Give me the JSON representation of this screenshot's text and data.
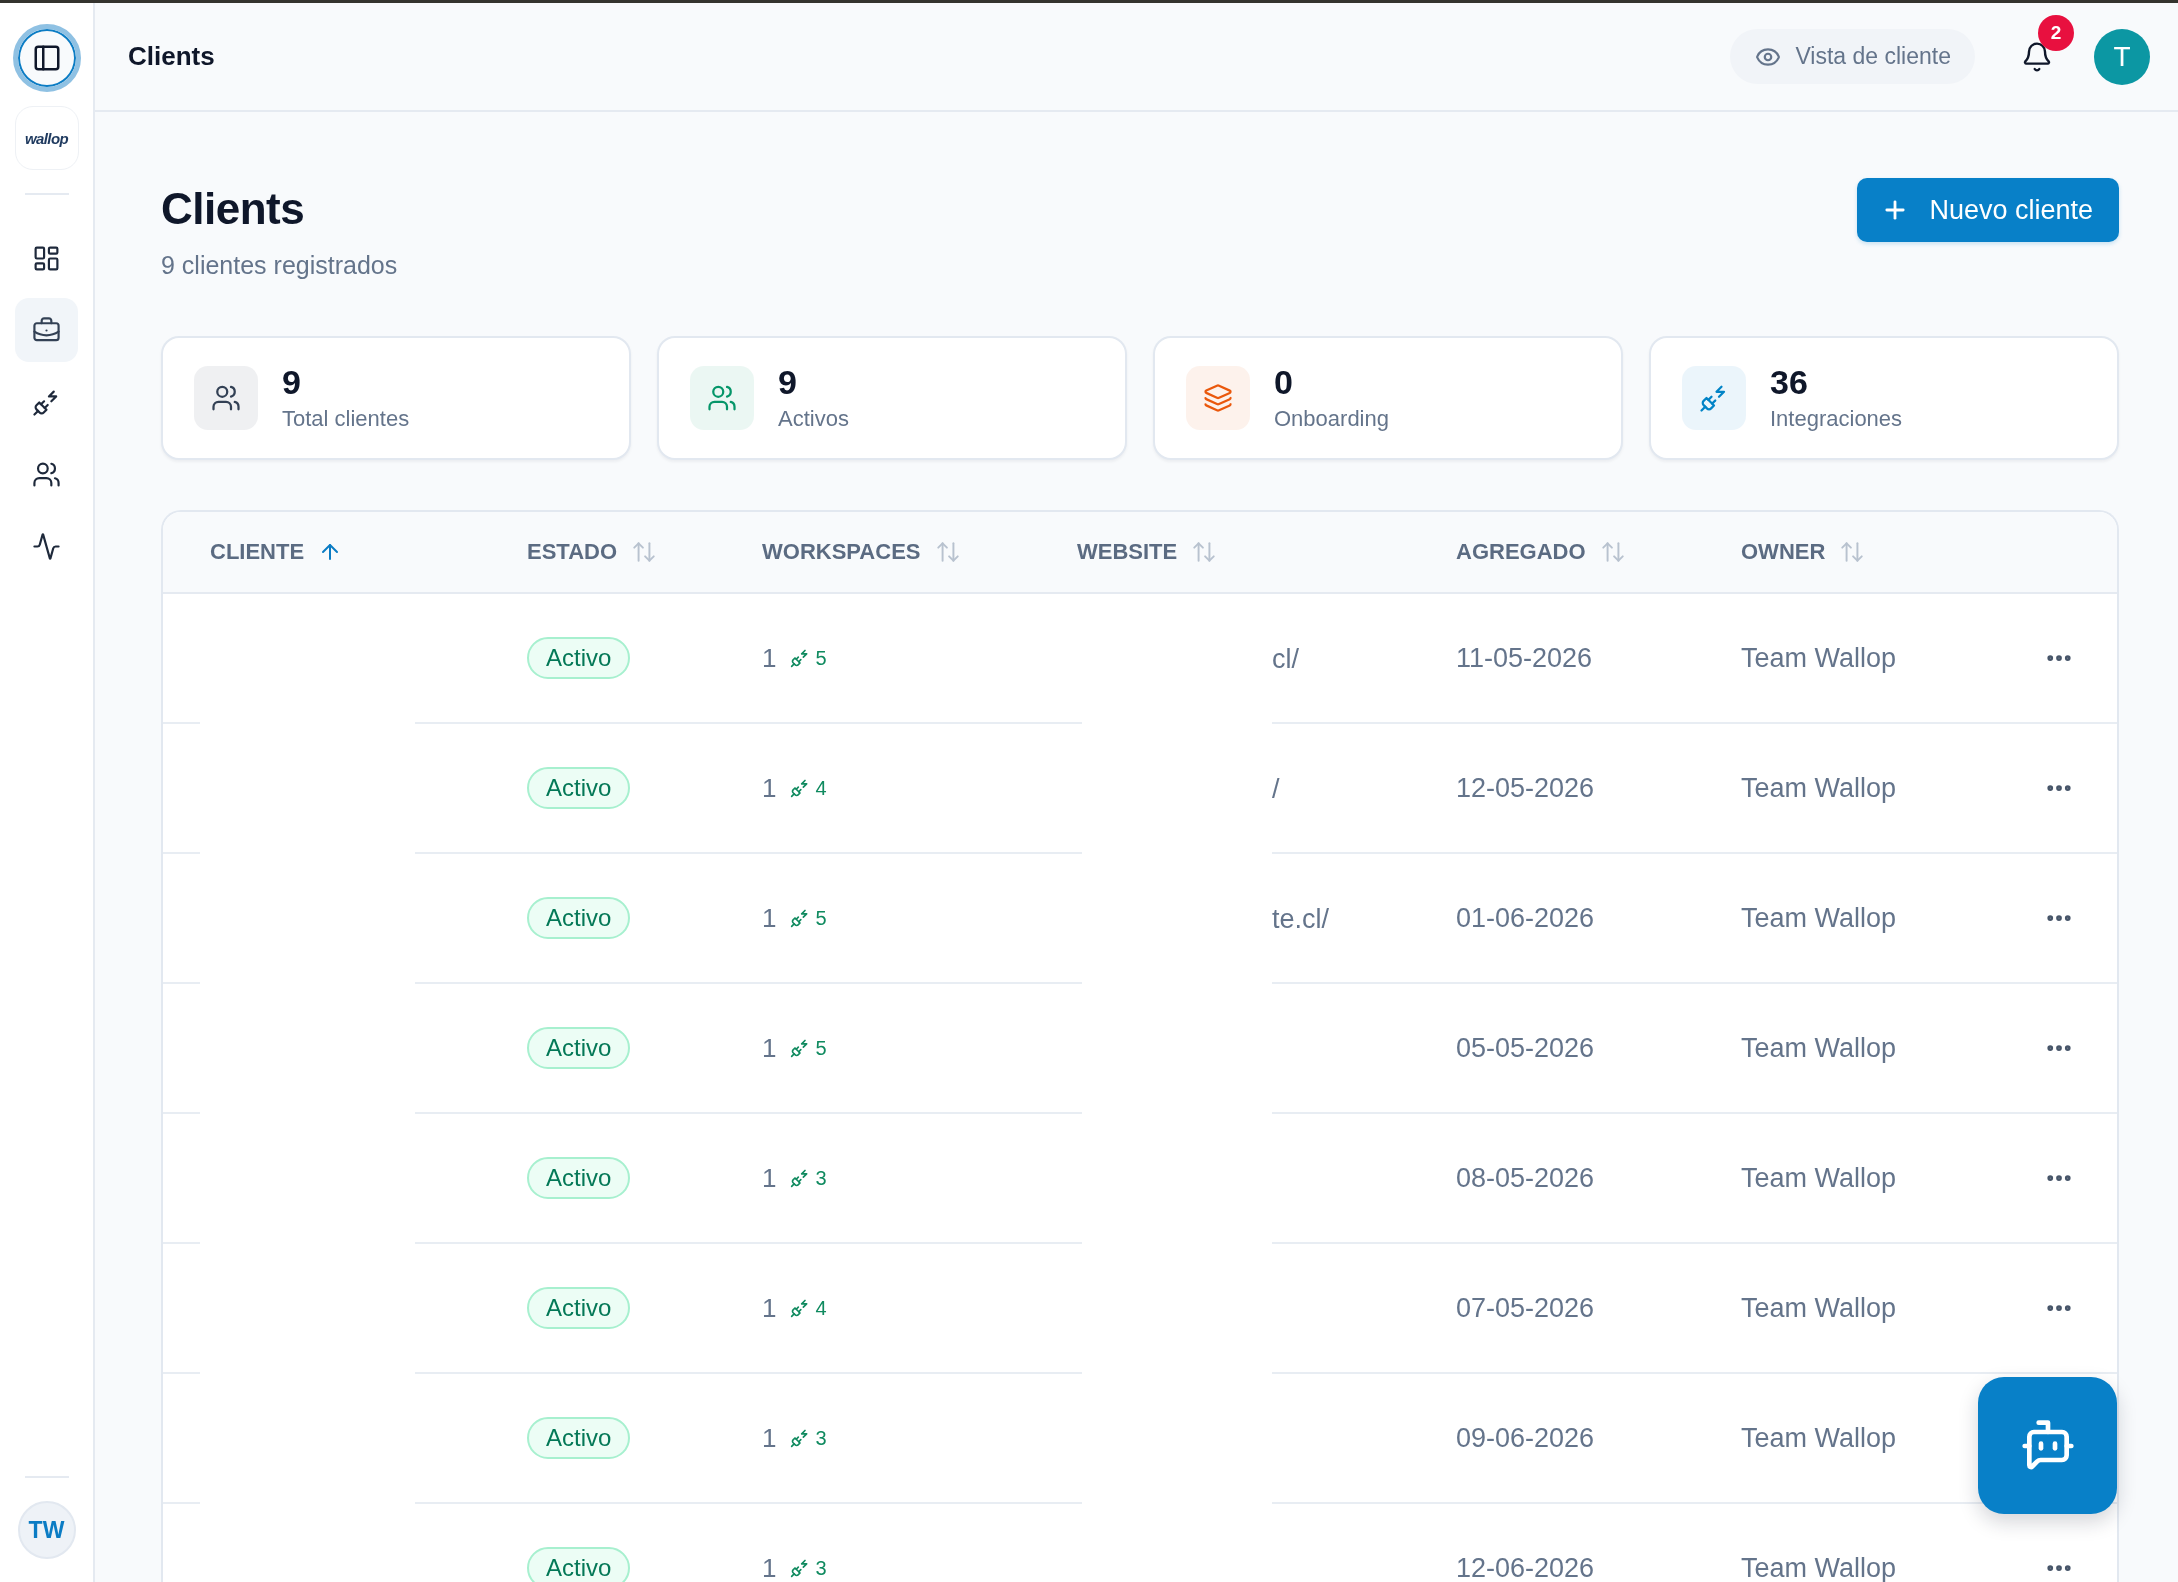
{
  "sidebar": {
    "toggle": {
      "focused": true
    },
    "logo": "wallop",
    "items": [
      {
        "kind": "dashboard",
        "selected": false
      },
      {
        "kind": "briefcase",
        "selected": true
      },
      {
        "kind": "plug",
        "selected": false
      },
      {
        "kind": "users",
        "selected": false
      },
      {
        "kind": "activity",
        "selected": false
      }
    ],
    "user_initials": "TW"
  },
  "top_bar": {
    "title": "Clients",
    "view_button": "Vista de cliente",
    "notifications": "2",
    "avatar": "T"
  },
  "header": {
    "title": "Clients",
    "subtitle": "9 clientes registrados",
    "new_button": "Nuevo cliente"
  },
  "stats": [
    {
      "kind": "users",
      "color": "#334155",
      "value": "9",
      "label": "Total clientes"
    },
    {
      "kind": "users",
      "color": "#059669",
      "value": "9",
      "label": "Activos"
    },
    {
      "kind": "layers",
      "color": "#ea580c",
      "value": "0",
      "label": "Onboarding"
    },
    {
      "kind": "plug",
      "color": "#0284c7",
      "value": "36",
      "label": "Integraciones"
    }
  ],
  "table": {
    "columns": [
      {
        "label": "CLIENTE",
        "sorted": true
      },
      {
        "label": "ESTADO",
        "sorted": false
      },
      {
        "label": "WORKSPACES",
        "sorted": false
      },
      {
        "label": "WEBSITE",
        "sorted": false
      },
      {
        "label": "AGREGADO",
        "sorted": false
      },
      {
        "label": "OWNER",
        "sorted": false
      }
    ],
    "rows": [
      {
        "status": "Activo",
        "workspaces": "1",
        "integrations": "5",
        "website": "cl/",
        "added": "11-05-2026",
        "owner": "Team Wallop",
        "menu": true
      },
      {
        "status": "Activo",
        "workspaces": "1",
        "integrations": "4",
        "website": "/",
        "added": "12-05-2026",
        "owner": "Team Wallop",
        "menu": true
      },
      {
        "status": "Activo",
        "workspaces": "1",
        "integrations": "5",
        "website": "te.cl/",
        "added": "01-06-2026",
        "owner": "Team Wallop",
        "menu": true
      },
      {
        "status": "Activo",
        "workspaces": "1",
        "integrations": "5",
        "added": "05-05-2026",
        "owner": "Team Wallop",
        "menu": true
      },
      {
        "status": "Activo",
        "workspaces": "1",
        "integrations": "3",
        "added": "08-05-2026",
        "owner": "Team Wallop",
        "menu": true
      },
      {
        "status": "Activo",
        "workspaces": "1",
        "integrations": "4",
        "added": "07-05-2026",
        "owner": "Team Wallop",
        "menu": true
      },
      {
        "status": "Activo",
        "workspaces": "1",
        "integrations": "3",
        "added": "09-06-2026",
        "owner": "Team Wallop"
      },
      {
        "status": "Activo",
        "workspaces": "1",
        "integrations": "3",
        "added": "12-06-2026",
        "owner": "Team Wallop",
        "menu": true
      }
    ]
  }
}
